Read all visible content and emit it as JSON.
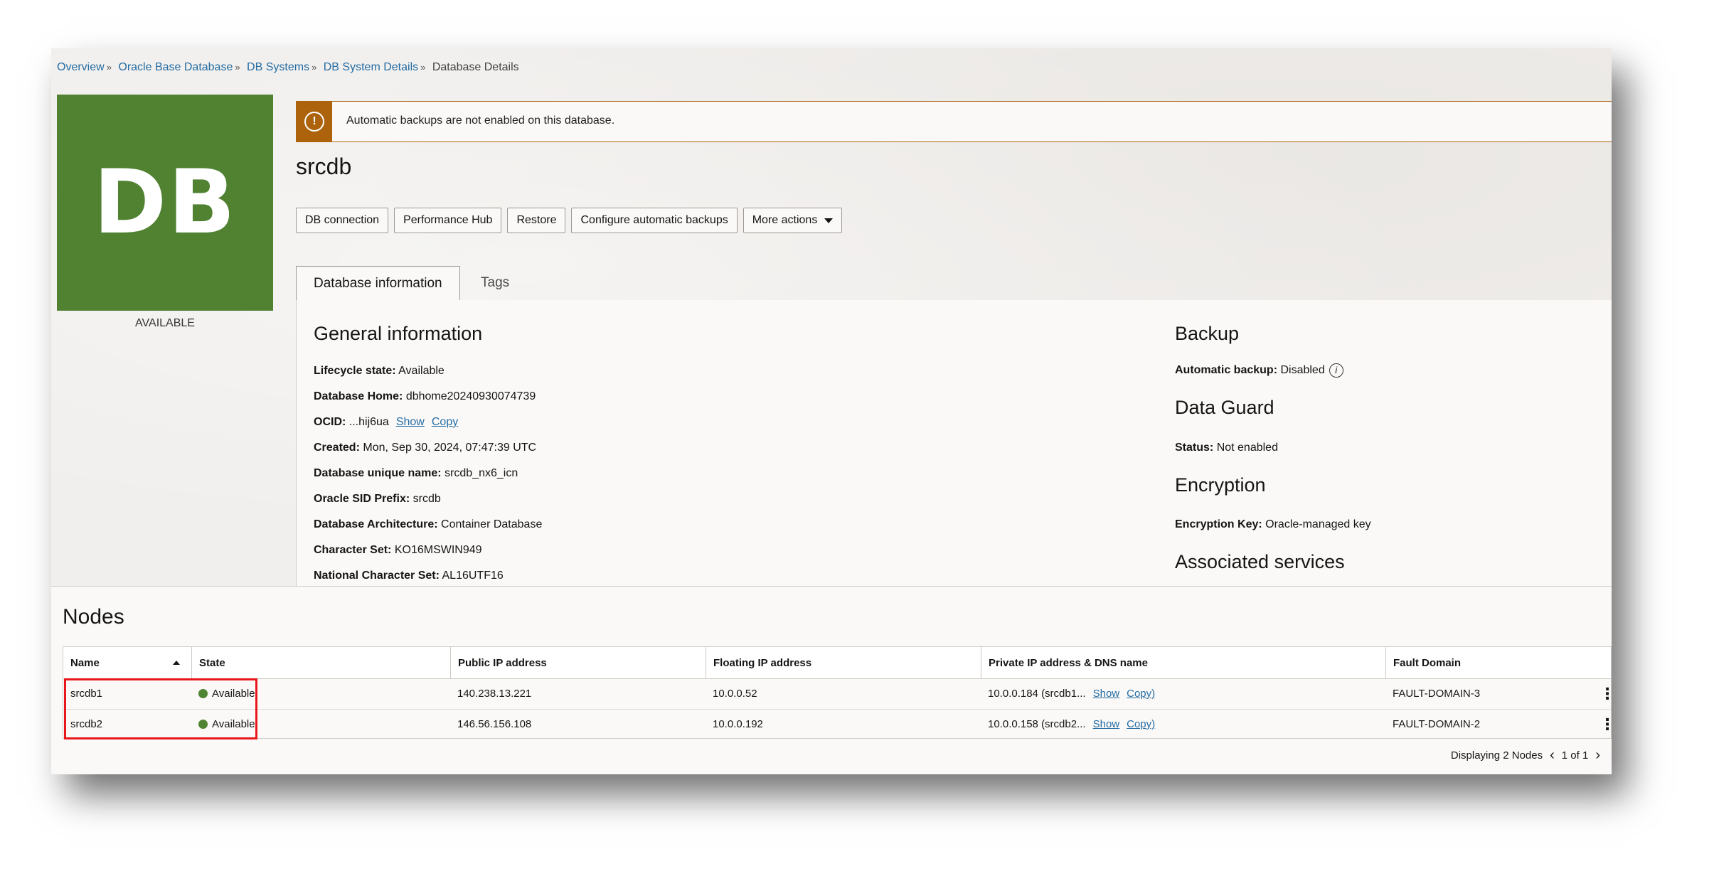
{
  "breadcrumb": {
    "items": [
      "Overview",
      "Oracle Base Database",
      "DB Systems",
      "DB System Details"
    ],
    "current": "Database Details",
    "separator": "»"
  },
  "db_tile": {
    "label": "DB",
    "status": "AVAILABLE",
    "color": "#508232"
  },
  "alert": {
    "message": "Automatic backups are not enabled on this database.",
    "icon": "warning-icon",
    "color": "#ac630c"
  },
  "title": "srcdb",
  "actions": {
    "db_connection": "DB connection",
    "performance_hub": "Performance Hub",
    "restore": "Restore",
    "configure_backups": "Configure automatic backups",
    "more_actions": "More actions"
  },
  "tabs": {
    "database_information": "Database information",
    "tags": "Tags"
  },
  "general": {
    "heading": "General information",
    "lifecycle_label": "Lifecycle state:",
    "lifecycle_value": "Available",
    "home_label": "Database Home:",
    "home_value": "dbhome20240930074739",
    "ocid_label": "OCID:",
    "ocid_value": "...hij6ua",
    "show": "Show",
    "copy": "Copy",
    "created_label": "Created:",
    "created_value": "Mon, Sep 30, 2024, 07:47:39 UTC",
    "unique_label": "Database unique name:",
    "unique_value": "srcdb_nx6_icn",
    "sid_label": "Oracle SID Prefix:",
    "sid_value": "srcdb",
    "arch_label": "Database Architecture:",
    "arch_value": "Container Database",
    "charset_label": "Character Set:",
    "charset_value": "KO16MSWIN949",
    "ncharset_label": "National Character Set:",
    "ncharset_value": "AL16UTF16"
  },
  "backup": {
    "heading": "Backup",
    "label": "Automatic backup:",
    "value": "Disabled"
  },
  "dataguard": {
    "heading": "Data Guard",
    "label": "Status:",
    "value": "Not enabled"
  },
  "encryption": {
    "heading": "Encryption",
    "label": "Encryption Key:",
    "value": "Oracle-managed key"
  },
  "associated": {
    "heading": "Associated services"
  },
  "nodes": {
    "title": "Nodes",
    "columns": [
      "Name",
      "State",
      "Public IP address",
      "Floating IP address",
      "Private IP address & DNS name",
      "Fault Domain"
    ],
    "rows": [
      {
        "name": "srcdb1",
        "state": "Available",
        "public_ip": "140.238.13.221",
        "floating_ip": "10.0.0.52",
        "private": "10.0.0.184 (srcdb1...",
        "show": "Show",
        "copy": "Copy)",
        "fault_domain": "FAULT-DOMAIN-3"
      },
      {
        "name": "srcdb2",
        "state": "Available",
        "public_ip": "146.56.156.108",
        "floating_ip": "10.0.0.192",
        "private": "10.0.0.158 (srcdb2...",
        "show": "Show",
        "copy": "Copy)",
        "fault_domain": "FAULT-DOMAIN-2"
      }
    ],
    "footer": "Displaying 2 Nodes",
    "pager": "1 of 1"
  }
}
